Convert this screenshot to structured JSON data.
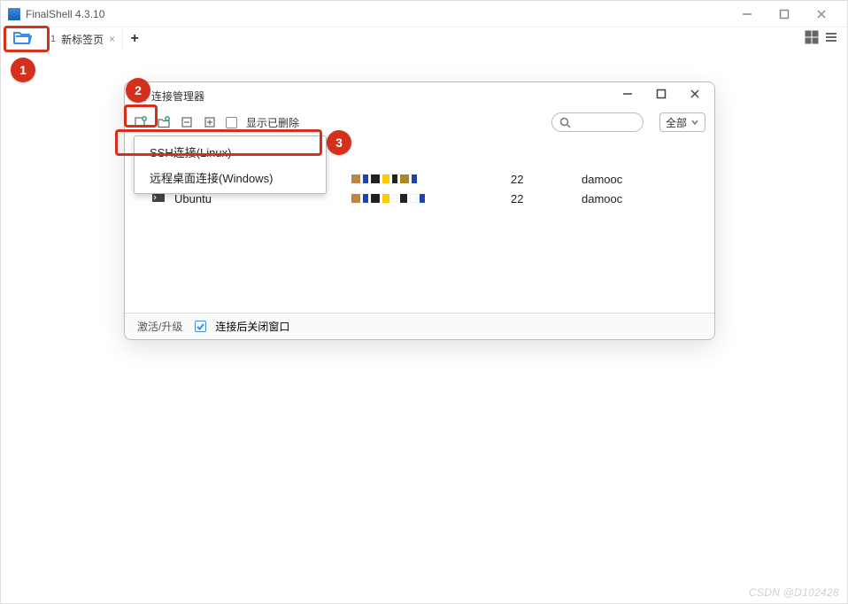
{
  "main": {
    "title": "FinalShell 4.3.10",
    "tab": {
      "num": "1",
      "label": "新标签页"
    }
  },
  "badges": {
    "one": "1",
    "two": "2",
    "three": "3"
  },
  "dialog": {
    "title": "连接管理器",
    "show_deleted": "显示已删除",
    "filter_label": "全部",
    "menu": {
      "ssh": "SSH连接(Linux)",
      "rdp": "远程桌面连接(Windows)"
    },
    "rows": [
      {
        "name": "",
        "port": "22",
        "user": "damooc"
      },
      {
        "name": "Ubuntu",
        "port": "22",
        "user": "damooc"
      }
    ],
    "footer": {
      "upgrade": "激活/升级",
      "close_on_connect": "连接后关闭窗口"
    }
  },
  "watermark": "CSDN @D102428"
}
